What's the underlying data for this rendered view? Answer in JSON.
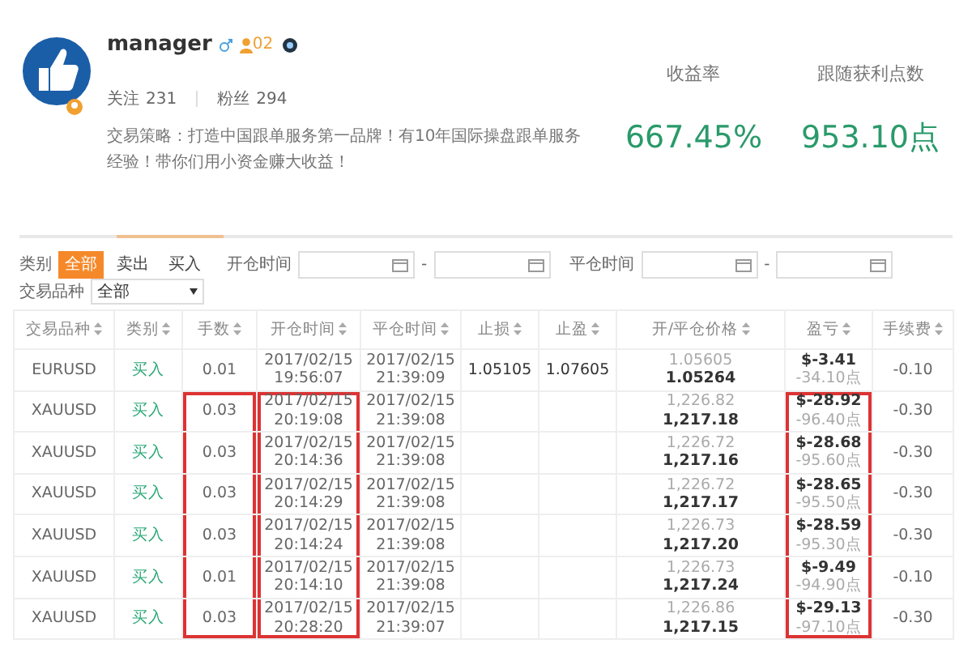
{
  "profile": {
    "name": "manager",
    "level": "02",
    "follow_label": "关注",
    "follow_count": "231",
    "fans_label": "粉丝",
    "fans_count": "294",
    "strategy": "交易策略：打造中国跟单服务第一品牌！有10年国际操盘跟单服务经验！带你们用小资金赚大收益！"
  },
  "stats": [
    {
      "label": "收益率",
      "value": "667.45%"
    },
    {
      "label": "跟随获利点数",
      "value": "953.10点"
    }
  ],
  "filters": {
    "type_label": "类别",
    "type_options": [
      {
        "label": "全部",
        "selected": true
      },
      {
        "label": "卖出",
        "selected": false
      },
      {
        "label": "买入",
        "selected": false
      }
    ],
    "open_time_label": "开仓时间",
    "close_time_label": "平仓时间",
    "range_sep": "-",
    "symbol_label": "交易品种",
    "symbol_value": "全部"
  },
  "table": {
    "columns": [
      "交易品种",
      "类别",
      "手数",
      "开仓时间",
      "平仓时间",
      "止损",
      "止盈",
      "开/平仓价格",
      "盈亏",
      "手续费"
    ],
    "rows": [
      {
        "symbol": "EURUSD",
        "side": "买入",
        "lots": "0.01",
        "open_date": "2017/02/15",
        "open_clock": "19:56:07",
        "close_date": "2017/02/15",
        "close_clock": "21:39:09",
        "stop_loss": "1.05105",
        "take_profit": "1.07605",
        "open_price": "1.05605",
        "close_price": "1.05264",
        "profit": "$-3.41",
        "points": "-34.10点",
        "fee": "-0.10",
        "highlighted": false
      },
      {
        "symbol": "XAUUSD",
        "side": "买入",
        "lots": "0.03",
        "open_date": "2017/02/15",
        "open_clock": "20:19:08",
        "close_date": "2017/02/15",
        "close_clock": "21:39:08",
        "stop_loss": "",
        "take_profit": "",
        "open_price": "1,226.82",
        "close_price": "1,217.18",
        "profit": "$-28.92",
        "points": "-96.40点",
        "fee": "-0.30",
        "highlighted": true
      },
      {
        "symbol": "XAUUSD",
        "side": "买入",
        "lots": "0.03",
        "open_date": "2017/02/15",
        "open_clock": "20:14:36",
        "close_date": "2017/02/15",
        "close_clock": "21:39:08",
        "stop_loss": "",
        "take_profit": "",
        "open_price": "1,226.72",
        "close_price": "1,217.16",
        "profit": "$-28.68",
        "points": "-95.60点",
        "fee": "-0.30",
        "highlighted": true
      },
      {
        "symbol": "XAUUSD",
        "side": "买入",
        "lots": "0.03",
        "open_date": "2017/02/15",
        "open_clock": "20:14:29",
        "close_date": "2017/02/15",
        "close_clock": "21:39:08",
        "stop_loss": "",
        "take_profit": "",
        "open_price": "1,226.72",
        "close_price": "1,217.17",
        "profit": "$-28.65",
        "points": "-95.50点",
        "fee": "-0.30",
        "highlighted": true
      },
      {
        "symbol": "XAUUSD",
        "side": "买入",
        "lots": "0.03",
        "open_date": "2017/02/15",
        "open_clock": "20:14:24",
        "close_date": "2017/02/15",
        "close_clock": "21:39:08",
        "stop_loss": "",
        "take_profit": "",
        "open_price": "1,226.73",
        "close_price": "1,217.20",
        "profit": "$-28.59",
        "points": "-95.30点",
        "fee": "-0.30",
        "highlighted": true
      },
      {
        "symbol": "XAUUSD",
        "side": "买入",
        "lots": "0.01",
        "open_date": "2017/02/15",
        "open_clock": "20:14:10",
        "close_date": "2017/02/15",
        "close_clock": "21:39:08",
        "stop_loss": "",
        "take_profit": "",
        "open_price": "1,226.73",
        "close_price": "1,217.24",
        "profit": "$-9.49",
        "points": "-94.90点",
        "fee": "-0.10",
        "highlighted": true
      },
      {
        "symbol": "XAUUSD",
        "side": "买入",
        "lots": "0.03",
        "open_date": "2017/02/15",
        "open_clock": "20:28:20",
        "close_date": "2017/02/15",
        "close_clock": "21:39:07",
        "stop_loss": "",
        "take_profit": "",
        "open_price": "1,226.86",
        "close_price": "1,217.15",
        "profit": "$-29.13",
        "points": "-97.10点",
        "fee": "-0.30",
        "highlighted": true
      }
    ]
  }
}
